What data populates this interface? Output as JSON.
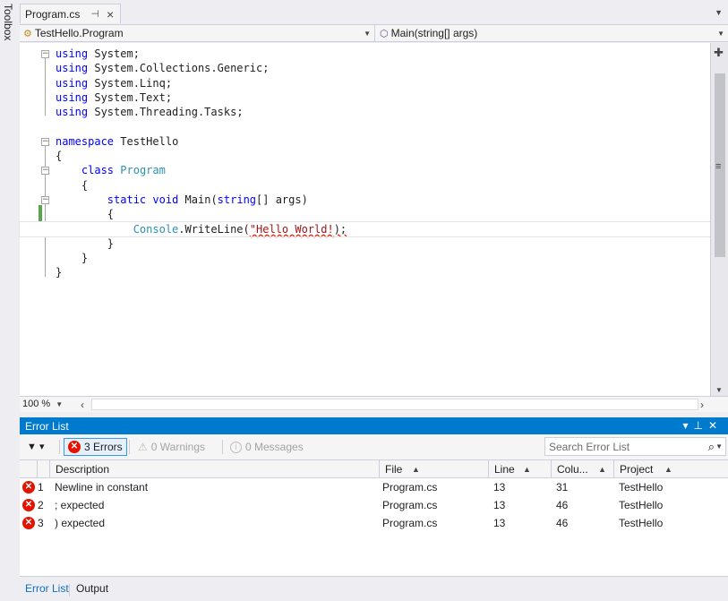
{
  "toolbox": {
    "label": "Toolbox"
  },
  "document_tab": {
    "name": "Program.cs",
    "pin_icon": "pin-icon",
    "close_icon": "close-icon"
  },
  "navigation": {
    "type_selector": "TestHello.Program",
    "member_selector": "Main(string[] args)"
  },
  "code": {
    "usings": [
      "System",
      "System.Collections.Generic",
      "System.Linq",
      "System.Text",
      "System.Threading.Tasks"
    ],
    "keyword_using": "using",
    "keyword_namespace": "namespace",
    "namespace_name": "TestHello",
    "open_brace": "{",
    "close_brace": "}",
    "keyword_class": "class",
    "class_name": "Program",
    "keyword_static": "static",
    "keyword_void": "void",
    "method_name": "Main",
    "param_open": "(",
    "keyword_string": "string",
    "param_rest": "[] args)",
    "console_type": "Console",
    "call_text": ".WriteLine(",
    "string_literal": "\"Hello World!",
    "error_tail": ");"
  },
  "zoom": {
    "level": "100 %"
  },
  "error_list": {
    "title": "Error List",
    "errors_btn": "3 Errors",
    "warnings_btn": "0 Warnings",
    "messages_btn": "0 Messages",
    "search_placeholder": "Search Error List",
    "columns": {
      "description": "Description",
      "file": "File",
      "line": "Line",
      "column": "Colu...",
      "project": "Project"
    },
    "rows": [
      {
        "num": "1",
        "description": "Newline in constant",
        "file": "Program.cs",
        "line": "13",
        "column": "31",
        "project": "TestHello"
      },
      {
        "num": "2",
        "description": "; expected",
        "file": "Program.cs",
        "line": "13",
        "column": "46",
        "project": "TestHello"
      },
      {
        "num": "3",
        "description": ") expected",
        "file": "Program.cs",
        "line": "13",
        "column": "46",
        "project": "TestHello"
      }
    ]
  },
  "bottom_tabs": {
    "error_list": "Error List",
    "output": "Output"
  },
  "colors": {
    "accent": "#007acc",
    "error": "#e51400",
    "keyword": "#0000ff",
    "type": "#2b91af",
    "string": "#a31515",
    "change_bar": "#57a64a"
  }
}
